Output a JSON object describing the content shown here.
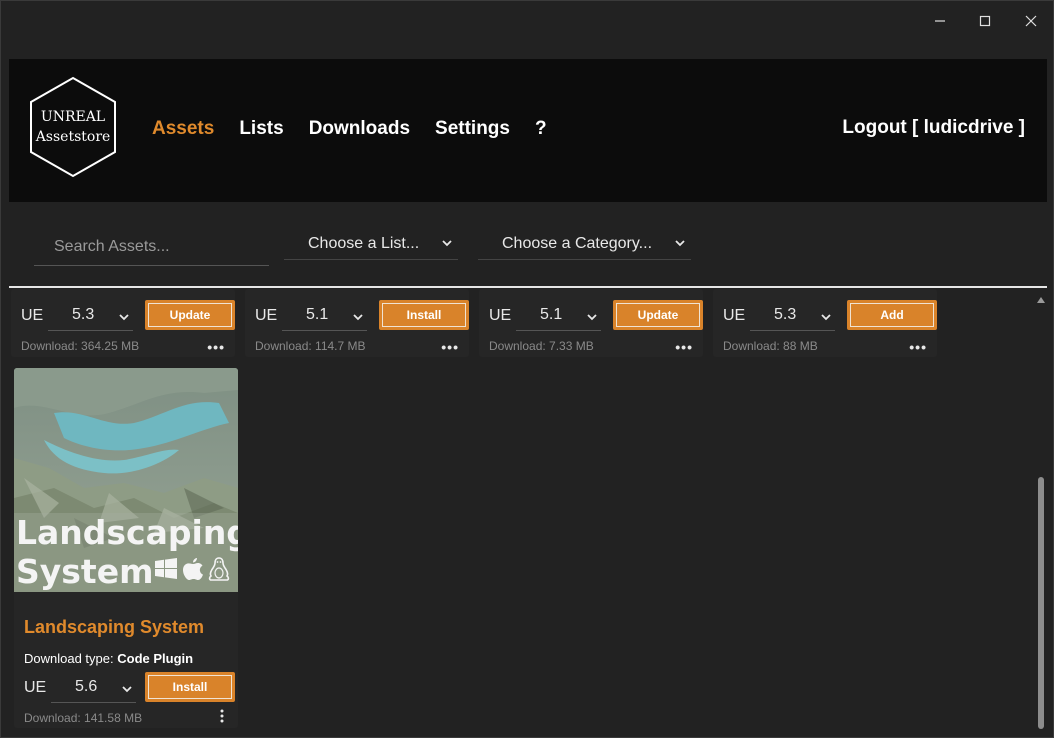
{
  "window": {
    "controls": {
      "minimize": "minimize-icon",
      "maximize": "maximize-icon",
      "close": "close-icon"
    }
  },
  "header": {
    "logo": {
      "line1": "UNREAL",
      "line2": "Assetstore"
    },
    "nav": [
      {
        "label": "Assets",
        "active": true
      },
      {
        "label": "Lists",
        "active": false
      },
      {
        "label": "Downloads",
        "active": false
      },
      {
        "label": "Settings",
        "active": false
      },
      {
        "label": "?",
        "active": false
      }
    ],
    "logout": "Logout [ ludicdrive ]"
  },
  "toolbar": {
    "search_placeholder": "Search Assets...",
    "list_select": "Choose a List...",
    "category_select": "Choose a Category..."
  },
  "colors": {
    "accent": "#e08a2c",
    "button": "#d9832a",
    "header_bg": "#0c0c0c",
    "page_bg": "#222222"
  },
  "cards": [
    {
      "ue_label": "UE",
      "version": "5.3",
      "action": "Update",
      "download": "Download: 364.25 MB",
      "more": "•••"
    },
    {
      "ue_label": "UE",
      "version": "5.1",
      "action": "Install",
      "download": "Download: 114.7 MB",
      "more": "•••"
    },
    {
      "ue_label": "UE",
      "version": "5.1",
      "action": "Update",
      "download": "Download: 7.33 MB",
      "more": "•••"
    },
    {
      "ue_label": "UE",
      "version": "5.3",
      "action": "Add",
      "download": "Download: 88 MB",
      "more": "•••"
    }
  ],
  "featured": {
    "thumb_line1": "Landscaping",
    "thumb_line2": "System",
    "title": "Landscaping System",
    "download_type_label": "Download type:",
    "download_type_value": "Code Plugin",
    "ue_label": "UE",
    "version": "5.6",
    "action": "Install",
    "download": "Download: 141.58 MB"
  }
}
